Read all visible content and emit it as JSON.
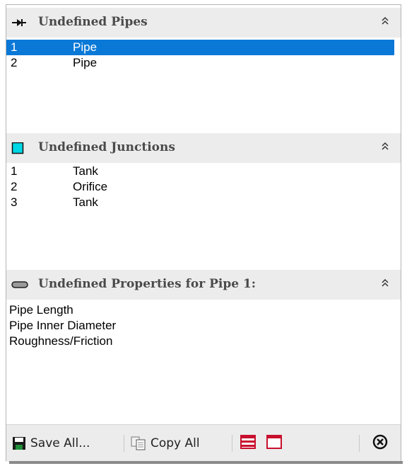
{
  "pipes_section": {
    "title": "Undefined Pipes",
    "collapse_glyph": "⌃",
    "icon": "pipe-arrow-icon",
    "rows": [
      {
        "num": "1",
        "type": "Pipe",
        "selected": true
      },
      {
        "num": "2",
        "type": "Pipe",
        "selected": false
      }
    ]
  },
  "junctions_section": {
    "title": "Undefined Junctions",
    "collapse_glyph": "⌃",
    "icon": "cyan-square-icon",
    "icon_color": "#00d8e6",
    "rows": [
      {
        "num": "1",
        "type": "Tank"
      },
      {
        "num": "2",
        "type": "Orifice"
      },
      {
        "num": "3",
        "type": "Tank"
      }
    ]
  },
  "properties_section": {
    "title": "Undefined Properties for Pipe 1:",
    "collapse_glyph": "⌃",
    "icon": "pipe-segment-icon",
    "items": [
      "Pipe Length",
      "Pipe Inner Diameter",
      "Roughness/Friction"
    ]
  },
  "toolbar": {
    "save_all_label": "Save All...",
    "copy_all_label": "Copy All",
    "close_glyph": "⊗"
  },
  "colors": {
    "selection": "#0a78d7",
    "header_bg": "#ececec",
    "accent_red": "#c8102e"
  }
}
